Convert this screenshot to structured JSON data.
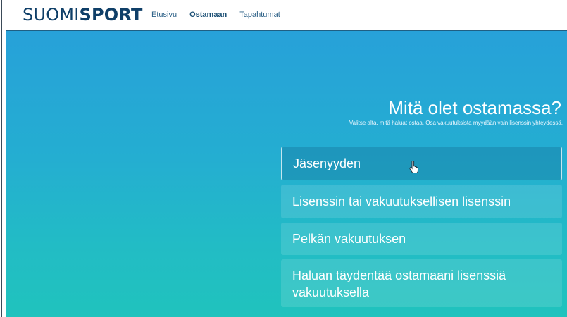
{
  "header": {
    "logo_light": "SUOMI",
    "logo_bold": "SPORT",
    "nav": [
      "Etusivu",
      "Ostamaan",
      "Tapahtumat"
    ],
    "active_nav": "Ostamaan"
  },
  "hero": {
    "question": "Mitä olet ostamassa?",
    "subtitle": "Valitse alta, mitä haluat ostaa. Osa vakuutuksista myydään vain lisenssin yhteydessä.",
    "options": [
      "Jäsenyyden",
      "Lisenssin tai vakuutuksellisen lisenssin",
      "Pelkän vakuutuksen",
      "Haluan täydentää ostamaani lisenssiä vakuutuksella"
    ]
  },
  "icons": {
    "cursor": "hand-pointer-icon"
  },
  "colors": {
    "brand_dark": "#0f3f68",
    "hero_top": "#27a1d9",
    "hero_bottom": "#20c3bd"
  }
}
